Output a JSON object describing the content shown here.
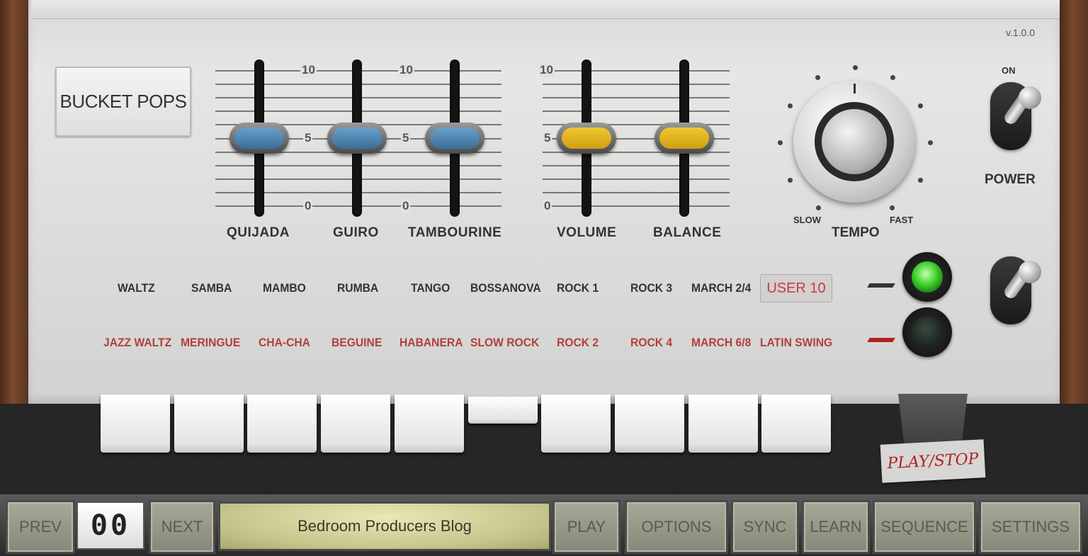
{
  "app": {
    "version": "v.1.0.0",
    "preset_name": "BUCKET POPS"
  },
  "sliders": [
    {
      "id": "quijada",
      "label": "QUIJADA",
      "value": 5,
      "scale_top": "10",
      "scale_mid": "5",
      "scale_bottom": "0",
      "color": "#4a82b0"
    },
    {
      "id": "guiro",
      "label": "GUIRO",
      "value": 5,
      "scale_top": "10",
      "scale_mid": "5",
      "scale_bottom": "0",
      "color": "#4a82b0"
    },
    {
      "id": "tambourine",
      "label": "TAMBOURINE",
      "value": 5,
      "color": "#4a82b0"
    },
    {
      "id": "volume",
      "label": "VOLUME",
      "value": 5,
      "scale_top": "10",
      "scale_mid": "5",
      "scale_bottom": "0",
      "color": "#e0b020"
    },
    {
      "id": "balance",
      "label": "BALANCE",
      "value": 5,
      "color": "#e0b020"
    }
  ],
  "tempo": {
    "label": "TEMPO",
    "slow_label": "SLOW",
    "fast_label": "FAST"
  },
  "power": {
    "on_label": "ON",
    "label": "POWER"
  },
  "rhythms_top": [
    "WALTZ",
    "SAMBA",
    "MAMBO",
    "RUMBA",
    "TANGO",
    "BOSSANOVA",
    "ROCK 1",
    "ROCK 3",
    "MARCH 2/4",
    "USER 10"
  ],
  "rhythms_bottom": [
    "JAZZ WALTZ",
    "MERINGUE",
    "CHA-CHA",
    "BEGUINE",
    "HABANERA",
    "SLOW ROCK",
    "ROCK 2",
    "ROCK 4",
    "MARCH 6/8",
    "LATIN SWING"
  ],
  "leds": {
    "top": "on",
    "bottom": "off"
  },
  "keys": {
    "count": 10,
    "pressed_index": 5
  },
  "playstop_label": "PLAY/STOP",
  "bottom_bar": {
    "prev_label": "PREV",
    "counter_value": "00",
    "next_label": "NEXT",
    "display_text": "Bedroom Producers Blog",
    "play_label": "PLAY",
    "options_label": "OPTIONS",
    "sync_label": "SYNC",
    "learn_label": "LEARN",
    "sequence_label": "SEQUENCE",
    "settings_label": "SETTINGS"
  },
  "colors": {
    "rhythm_top": "#333333",
    "rhythm_bottom": "#b04040",
    "led_on": "#3ad02a"
  }
}
